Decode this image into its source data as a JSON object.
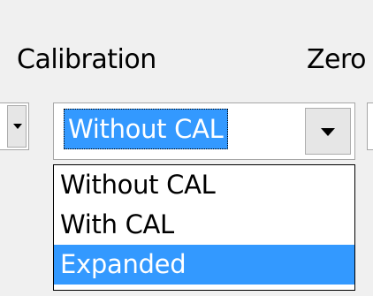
{
  "labels": {
    "calibration": "Calibration",
    "zero": "Zero"
  },
  "combo": {
    "value": "Without CAL",
    "icon": "chevron-down-icon"
  },
  "dropdown": {
    "options": [
      "Without CAL",
      "With CAL",
      "Expanded"
    ],
    "highlighted": "Expanded"
  },
  "colors": {
    "selection": "#3399ff",
    "background": "#f0f0f0"
  }
}
